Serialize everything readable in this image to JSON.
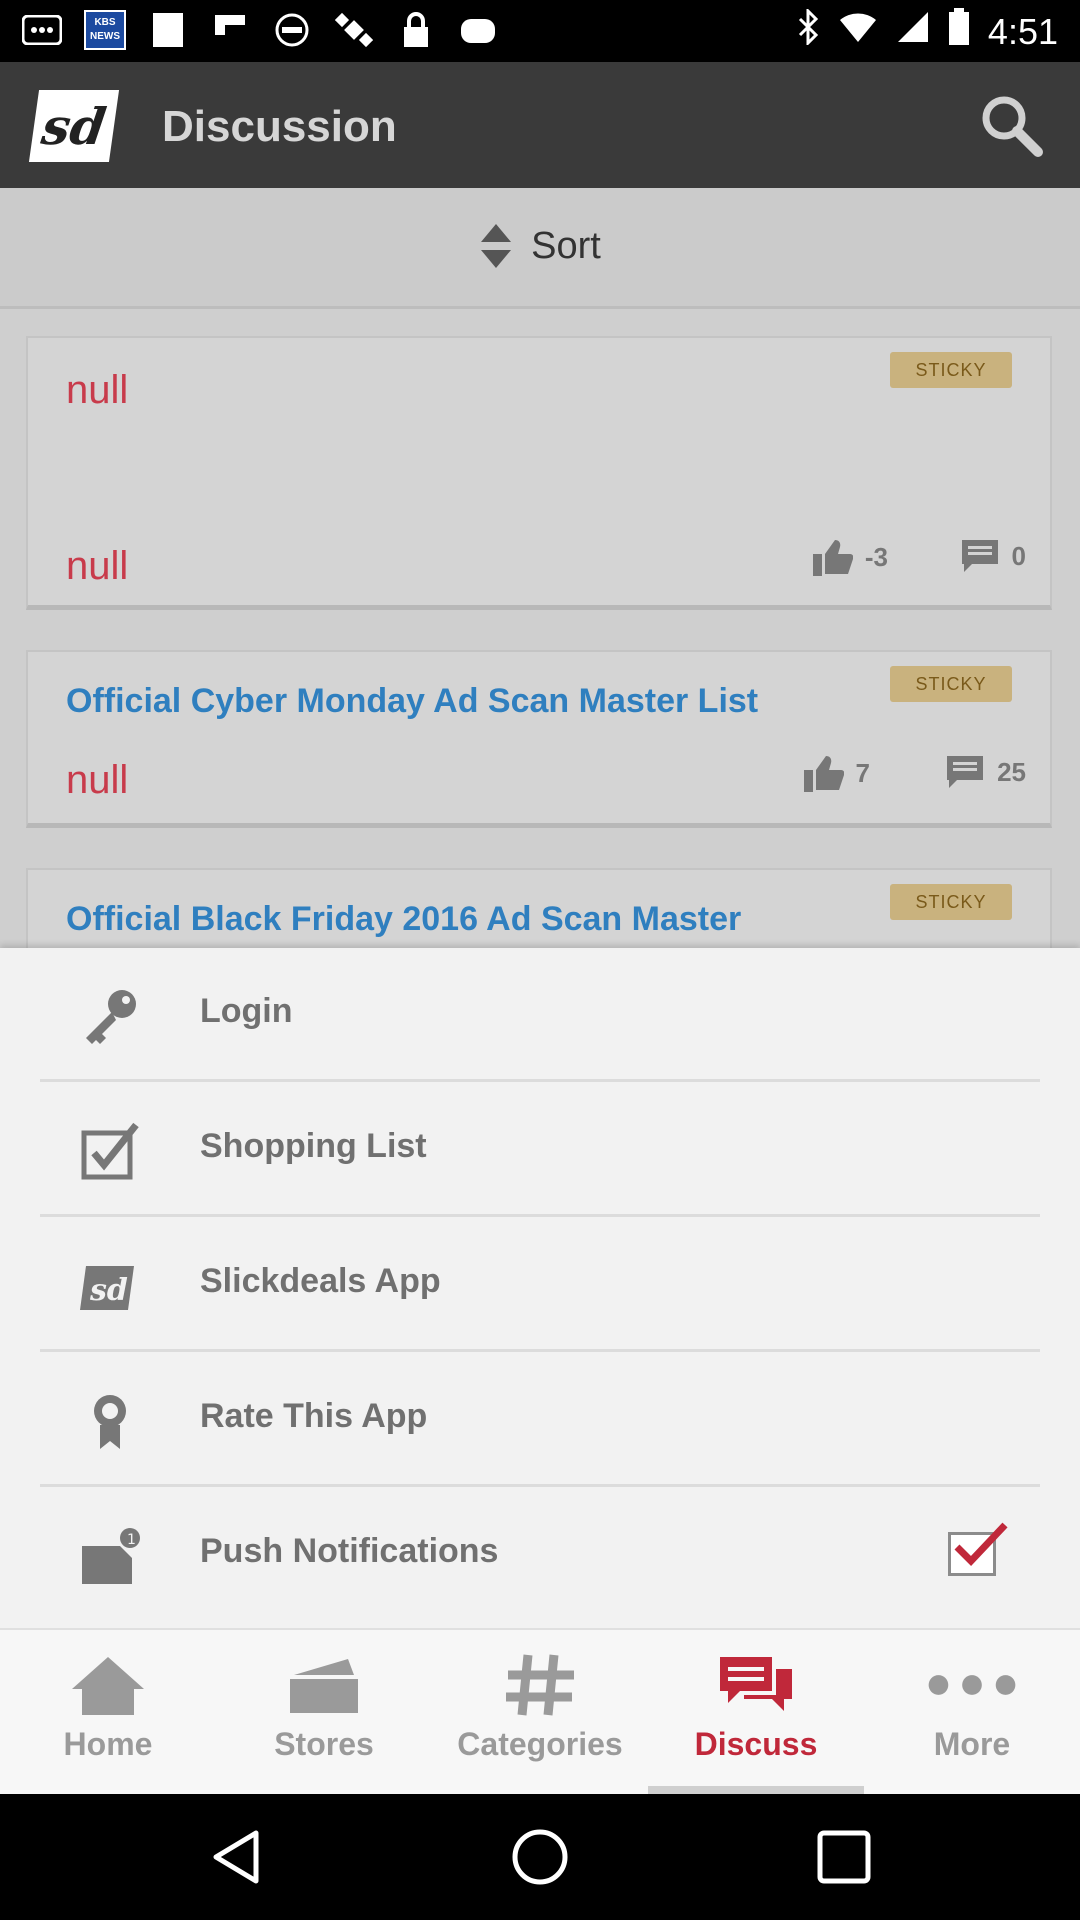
{
  "status_bar": {
    "time": "4:51",
    "kbs_label": "KBS NEWS",
    "icons": [
      "notification-icon",
      "kbs-news-icon",
      "blank-icon",
      "flipboard-icon",
      "blocked-icon",
      "satellite-icon",
      "lock-icon",
      "game-icon",
      "bluetooth-icon",
      "wifi-icon",
      "signal-icon",
      "battery-icon"
    ]
  },
  "app_bar": {
    "logo_text": "sd",
    "title": "Discussion",
    "search_icon": "search-icon"
  },
  "sort": {
    "label": "Sort"
  },
  "cards": [
    {
      "title": "null",
      "title_color": "#c83b4b",
      "badge": "STICKY",
      "subtitle": "null",
      "likes": "-3",
      "comments": "0"
    },
    {
      "title": "Official Cyber Monday Ad Scan Master List",
      "title_color": "#2f7fbf",
      "badge": "STICKY",
      "subtitle": "null",
      "likes": "7",
      "comments": "25"
    },
    {
      "title": "Official Black Friday 2016 Ad Scan Master",
      "title_color": "#2f7fbf",
      "badge": "STICKY"
    }
  ],
  "menu": {
    "items": [
      {
        "label": "Login",
        "icon": "key-icon"
      },
      {
        "label": "Shopping List",
        "icon": "checkbox-icon"
      },
      {
        "label": "Slickdeals App",
        "icon": "slickdeals-icon"
      },
      {
        "label": "Rate This App",
        "icon": "award-icon"
      },
      {
        "label": "Push Notifications",
        "icon": "notification-badge-icon",
        "checked": true
      }
    ]
  },
  "bottom_nav": {
    "items": [
      {
        "label": "Home",
        "icon": "home-icon"
      },
      {
        "label": "Stores",
        "icon": "stores-icon"
      },
      {
        "label": "Categories",
        "icon": "hash-icon"
      },
      {
        "label": "Discuss",
        "icon": "chat-icon",
        "active": true
      },
      {
        "label": "More",
        "icon": "more-icon"
      }
    ]
  },
  "colors": {
    "accent_red": "#c0283a",
    "link_blue": "#2f7fbf",
    "sticky_bg": "#c9b27e",
    "appbar": "#3a3a3a"
  }
}
